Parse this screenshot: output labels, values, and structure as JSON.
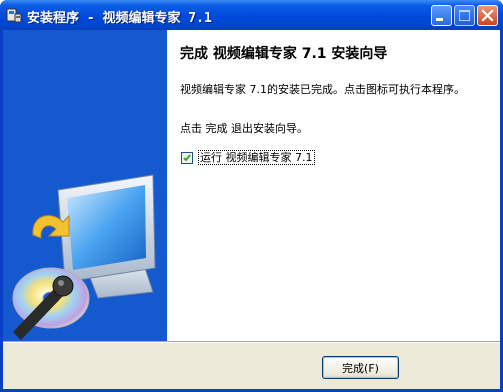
{
  "window": {
    "title": "安装程序 - 视频编辑专家 7.1",
    "app_icon": "installer-icon",
    "controls": [
      "minimize-icon",
      "maximize-icon",
      "close-icon"
    ]
  },
  "wizard": {
    "heading": "完成 视频编辑专家 7.1 安装向导",
    "message": "视频编辑专家 7.1的安装已完成。点击图标可执行本程序。",
    "instruction": "点击 完成 退出安装向导。",
    "run_option": {
      "label": "运行 视频编辑专家 7.1",
      "checked": true
    },
    "side_image": "computer-cd-installer-artwork"
  },
  "footer": {
    "finish_label": "完成(F)"
  },
  "colors": {
    "titlebar": "#0054e3",
    "side_panel": "#1a64d6",
    "footer_bg": "#ece9d8",
    "close_button": "#c7461d"
  }
}
